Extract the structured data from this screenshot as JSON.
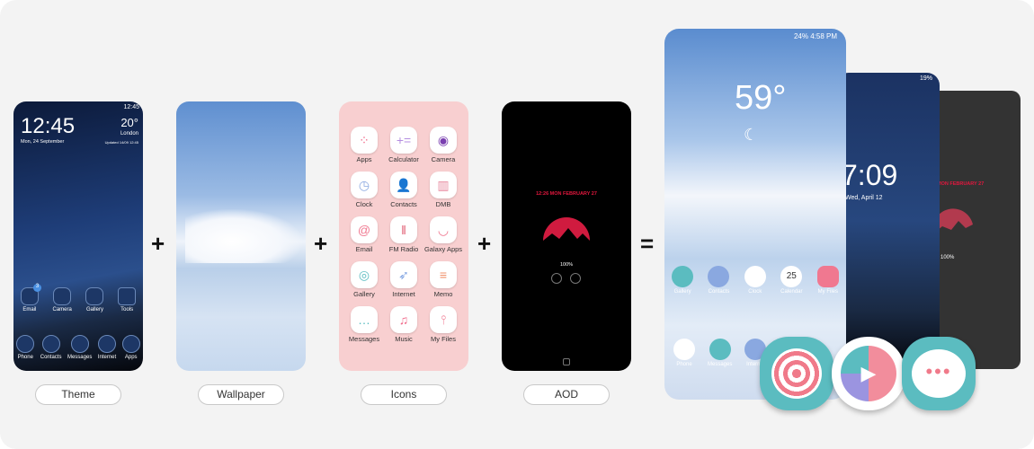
{
  "theme_phone": {
    "status_time": "12:45",
    "clock": "12:45",
    "date": "Mon, 24 September",
    "temp": "20°",
    "location": "London",
    "updated": "Updated 14/09 12:45",
    "home_apps": [
      {
        "label": "Email",
        "badge": "3"
      },
      {
        "label": "Camera"
      },
      {
        "label": "Gallery"
      },
      {
        "label": "Tools"
      }
    ],
    "dock": [
      "Phone",
      "Contacts",
      "Messages",
      "Internet",
      "Apps"
    ]
  },
  "icon_grid": [
    {
      "label": "Apps",
      "icon": "apps-grid",
      "color": "#f06a8a"
    },
    {
      "label": "Calculator",
      "icon": "plus-equals",
      "color": "#b48de0"
    },
    {
      "label": "Camera",
      "icon": "camera-lens",
      "color": "#7a3fb0"
    },
    {
      "label": "Clock",
      "icon": "clock",
      "color": "#8aa8e0"
    },
    {
      "label": "Contacts",
      "icon": "person",
      "color": "#7fa3e2"
    },
    {
      "label": "DMB",
      "icon": "tv-bars",
      "color": "#e88aa0"
    },
    {
      "label": "Email",
      "icon": "at-envelope",
      "color": "#f07890"
    },
    {
      "label": "FM Radio",
      "icon": "radio-bars",
      "color": "#e05a70"
    },
    {
      "label": "Galaxy Apps",
      "icon": "shopping-bag",
      "color": "#f07890"
    },
    {
      "label": "Gallery",
      "icon": "lollipop",
      "color": "#5bbcc0"
    },
    {
      "label": "Internet",
      "icon": "compass",
      "color": "#7fa3e2"
    },
    {
      "label": "Memo",
      "icon": "notepad",
      "color": "#f0906a"
    },
    {
      "label": "Messages",
      "icon": "chat-bubble",
      "color": "#5bbcc0"
    },
    {
      "label": "Music",
      "icon": "music-note",
      "color": "#f06a8a"
    },
    {
      "label": "My Files",
      "icon": "folder",
      "color": "#f07890"
    }
  ],
  "aod_phone": {
    "time_date": "12:26  MON FEBRUARY 27",
    "battery": "100%",
    "accent": "#e3173e"
  },
  "labels": {
    "theme": "Theme",
    "wallpaper": "Wallpaper",
    "icons": "Icons",
    "aod": "AOD"
  },
  "operators": {
    "plus": "+",
    "equals": "="
  },
  "result_front": {
    "status": "24% 4:58 PM",
    "temp": "59°",
    "apps": [
      "Gallery",
      "Contacts",
      "Clock",
      "Calendar",
      "My Files"
    ],
    "calendar_day": "25",
    "dock": [
      "Phone",
      "Messages",
      "Internet"
    ]
  },
  "result_mid": {
    "status": "19%",
    "clock": "7:09",
    "date": "Wed, April 12"
  },
  "result_back": {
    "date": "MON FEBRUARY 27",
    "battery": "100%"
  }
}
